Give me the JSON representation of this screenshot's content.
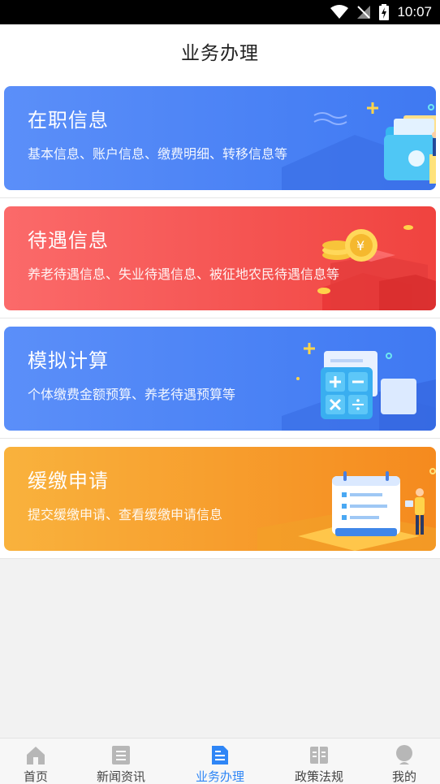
{
  "status_bar": {
    "time": "10:07"
  },
  "header": {
    "title": "业务办理"
  },
  "cards": [
    {
      "title": "在职信息",
      "desc": "基本信息、账户信息、缴费明细、转移信息等"
    },
    {
      "title": "待遇信息",
      "desc": "养老待遇信息、失业待遇信息、被征地农民待遇信息等"
    },
    {
      "title": "模拟计算",
      "desc": "个体缴费金额预算、养老待遇预算等"
    },
    {
      "title": "缓缴申请",
      "desc": "提交缓缴申请、查看缓缴申请信息"
    }
  ],
  "tabbar": {
    "items": [
      {
        "label": "首页",
        "icon": "home-icon"
      },
      {
        "label": "新闻资讯",
        "icon": "news-icon"
      },
      {
        "label": "业务办理",
        "icon": "business-icon"
      },
      {
        "label": "政策法规",
        "icon": "policy-icon"
      },
      {
        "label": "我的",
        "icon": "profile-icon"
      }
    ],
    "active_index": 2,
    "active_color": "#2f86f6"
  },
  "colors": {
    "blue_card": "#4a82f5",
    "red_card": "#f4534f",
    "orange_card": "#f79a2a"
  }
}
